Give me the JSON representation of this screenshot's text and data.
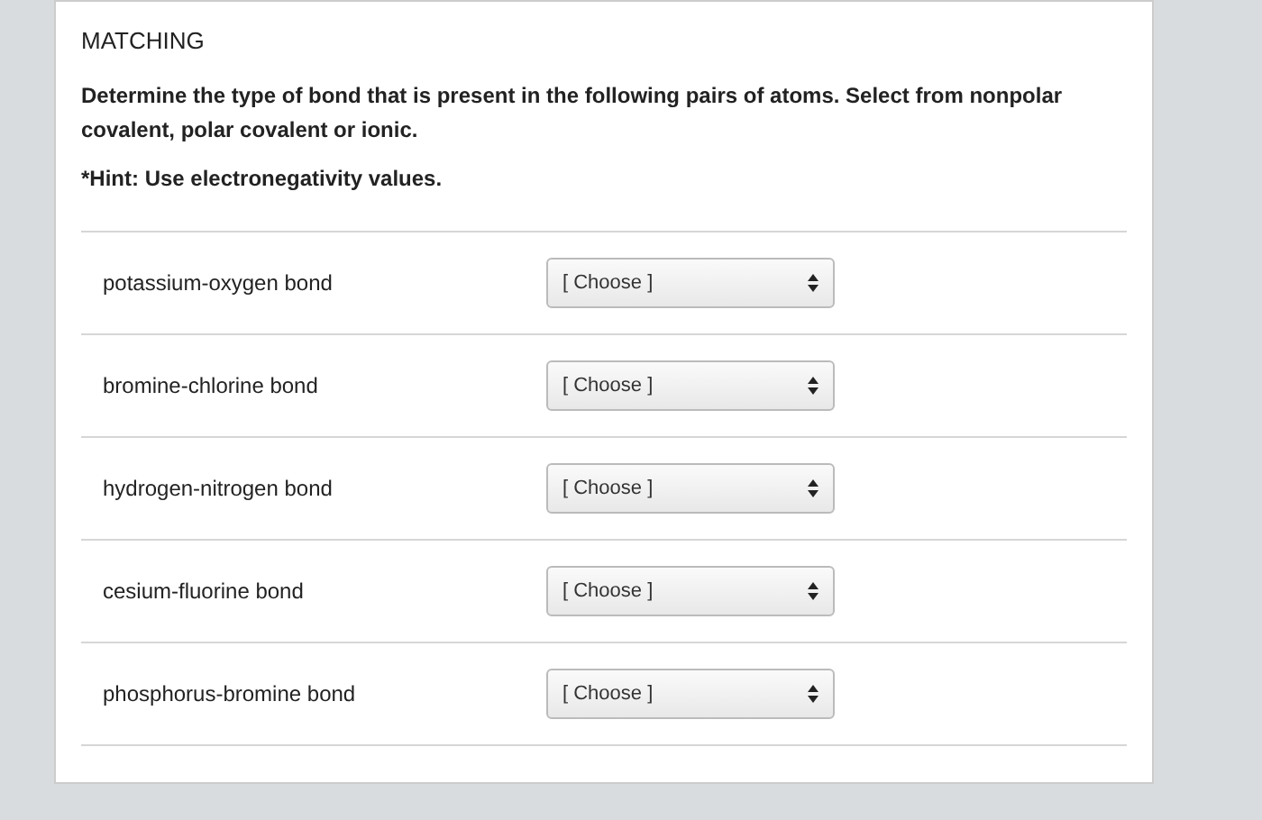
{
  "heading": "MATCHING",
  "instructions": "Determine the type of bond that is present in the following pairs of atoms. Select from nonpolar covalent, polar covalent or ionic.",
  "hint": "*Hint: Use electronegativity values.",
  "rows": [
    {
      "prompt": "potassium-oxygen bond",
      "answer": "[ Choose ]"
    },
    {
      "prompt": "bromine-chlorine bond",
      "answer": "[ Choose ]"
    },
    {
      "prompt": "hydrogen-nitrogen bond",
      "answer": "[ Choose ]"
    },
    {
      "prompt": "cesium-fluorine bond",
      "answer": "[ Choose ]"
    },
    {
      "prompt": "phosphorus-bromine bond",
      "answer": "[ Choose ]"
    }
  ]
}
